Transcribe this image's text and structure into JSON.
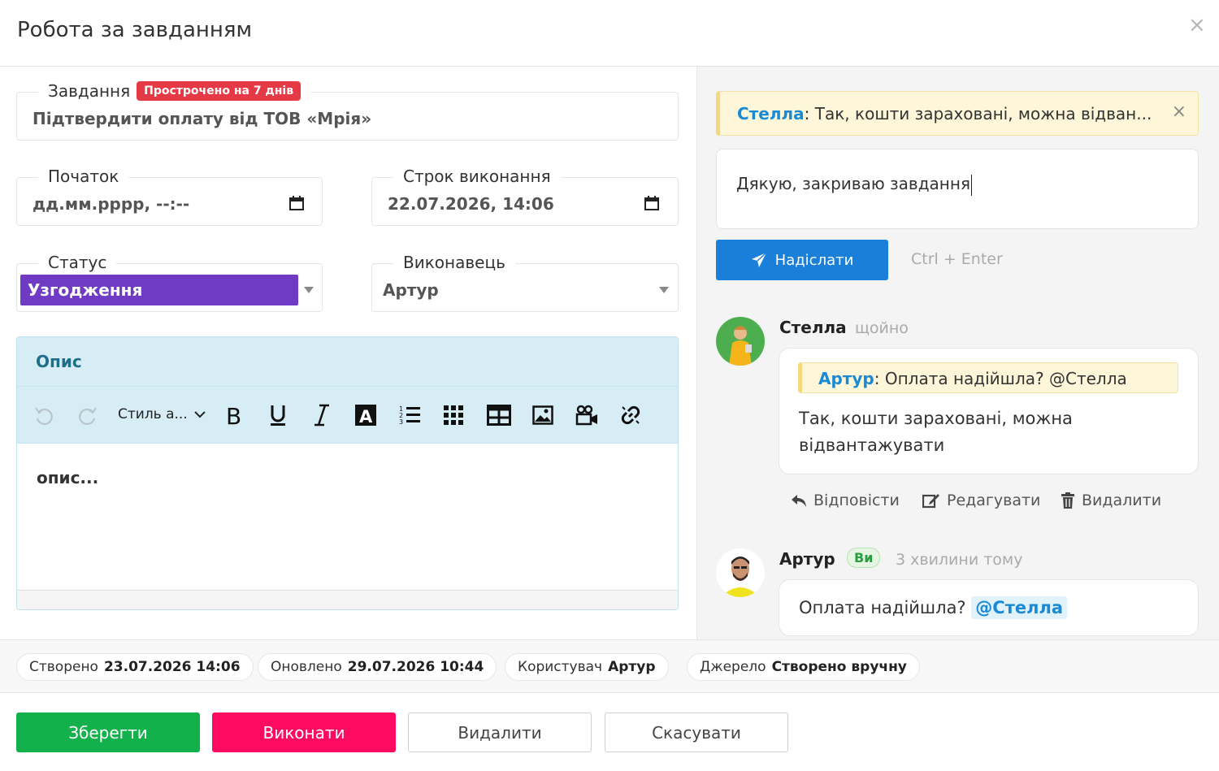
{
  "modal": {
    "title": "Робота за завданням",
    "close_glyph": "×"
  },
  "task": {
    "label": "Завдання",
    "overdue_badge": "Прострочено на 7 днів",
    "value": "Підтвердити оплату від ТОВ «Мрія»"
  },
  "start": {
    "label": "Початок",
    "value": "дд.мм.рррр, --:--"
  },
  "deadline": {
    "label": "Строк виконання",
    "value": "22.07.2026, 14:06"
  },
  "status": {
    "label": "Статус",
    "value": "Узгодження",
    "color": "#6f3ac4"
  },
  "assignee": {
    "label": "Виконавець",
    "value": "Артур"
  },
  "description": {
    "title": "Опис",
    "style_select": "Стиль а...",
    "placeholder": "опис...",
    "toolbar_icons": [
      "undo-icon",
      "redo-icon",
      "bold-icon",
      "underline-icon",
      "italic-icon",
      "text-color-icon",
      "numbered-list-icon",
      "grid-icon",
      "table-icon",
      "image-icon",
      "video-icon",
      "link-icon"
    ]
  },
  "chat": {
    "quote": {
      "author": "Стелла",
      "text": ": Так, кошти зараховані, можна відван..."
    },
    "reply_text": "Дякую, закриваю завдання",
    "send_label": "Надіслати",
    "send_hint": "Ctrl + Enter",
    "comments": [
      {
        "author": "Стелла",
        "time": "щойно",
        "quote_author": "Артур",
        "quote_text": ": Оплата надійшла? @Стелла",
        "text": "Так, кошти зараховані, можна відвантажувати",
        "actions": [
          "Відповісти",
          "Редагувати",
          "Видалити"
        ]
      },
      {
        "author": "Артур",
        "you_badge": "Ви",
        "time": "3 хвилини тому",
        "text": "Оплата надійшла?",
        "mention": "@Стелла"
      }
    ]
  },
  "meta": {
    "created_label": "Створено",
    "created_value": "23.07.2026 14:06",
    "updated_label": "Оновлено",
    "updated_value": "29.07.2026 10:44",
    "user_label": "Користувач",
    "user_value": "Артур",
    "source_label": "Джерело",
    "source_value": "Створено вручну"
  },
  "footer": {
    "save": "Зберегти",
    "done": "Виконати",
    "delete": "Видалити",
    "cancel": "Скасувати"
  },
  "colors": {
    "save": "#12b14b",
    "done": "#ff0a61",
    "send": "#1a7fd9",
    "mention": "#1a8ad4",
    "overdue": "#e63946"
  }
}
